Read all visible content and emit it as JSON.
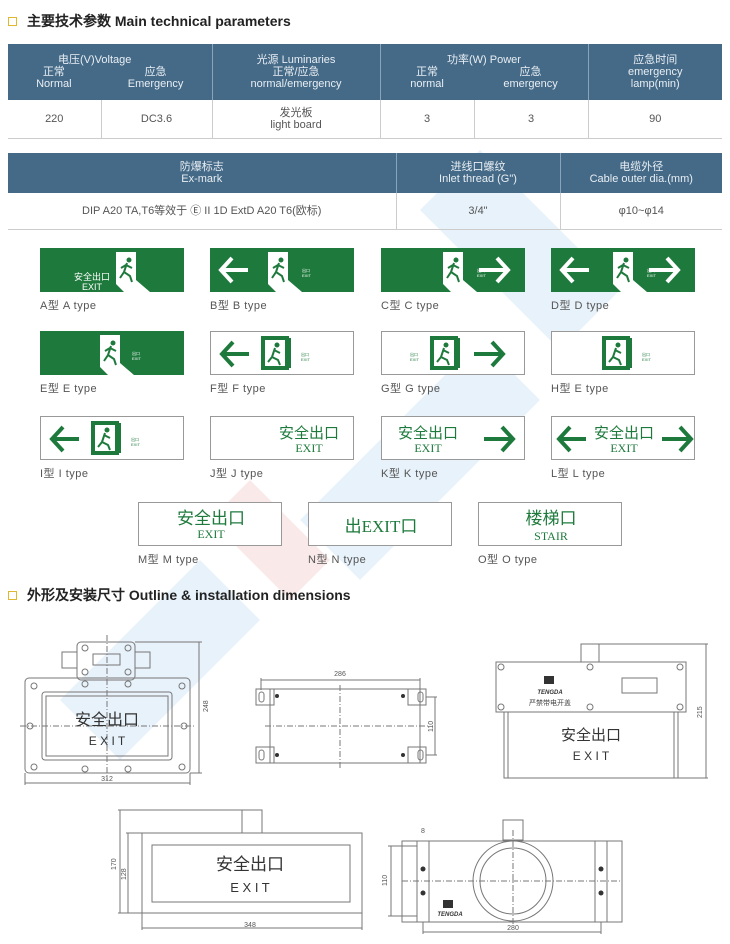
{
  "sections": {
    "params_title": "主要技术参数 Main technical parameters",
    "dims_title": "外形及安装尺寸  Outline & installation dimensions"
  },
  "table1": {
    "voltage": {
      "title": "电压(V)Voltage",
      "normal_cn": "正常",
      "normal_en": "Normal",
      "emergency_cn": "应急",
      "emergency_en": "Emergency"
    },
    "luminaries": {
      "title": "光源 Luminaries",
      "sub_cn": "正常/应急",
      "sub_en": "normal/emergency"
    },
    "power": {
      "title": "功率(W) Power",
      "normal_cn": "正常",
      "normal_en": "normal",
      "emergency_cn": "应急",
      "emergency_en": "emergency"
    },
    "time": {
      "title_cn": "应急时间",
      "title_en1": "emergency",
      "title_en2": "lamp(min)"
    },
    "row": {
      "v_normal": "220",
      "v_emergency": "DC3.6",
      "lum_cn": "发光板",
      "lum_en": "light board",
      "p_normal": "3",
      "p_emergency": "3",
      "time": "90"
    }
  },
  "table2": {
    "exmark": {
      "title_cn": "防爆标志",
      "title_en": "Ex-mark"
    },
    "inlet": {
      "title_cn": "进线口螺纹",
      "title_en": "Inlet thread (G\")"
    },
    "cable": {
      "title_cn": "电缆外径",
      "title_en": "Cable outer dia.(mm)"
    },
    "row": {
      "exmark": "DIP A20 TA,T6等效于 Ⓔ II 1D ExtD A20 T6(欧标)",
      "inlet": "3/4\"",
      "cable": "φ10~φ14"
    }
  },
  "sign_text": {
    "cn": "安全出口",
    "exit": "EXIT",
    "tiny_cn": "出口",
    "exit_mid": "出EXIT口",
    "stair_cn": "楼梯口",
    "stair_en": "STAIR"
  },
  "sign_types": [
    {
      "caption": "A型 A type"
    },
    {
      "caption": "B型 B type"
    },
    {
      "caption": "C型 C type"
    },
    {
      "caption": "D型 D type"
    },
    {
      "caption": "E型 E type"
    },
    {
      "caption": "F型 F type"
    },
    {
      "caption": "G型 G type"
    },
    {
      "caption": "H型 E type"
    },
    {
      "caption": "I型 I type"
    },
    {
      "caption": "J型 J type"
    },
    {
      "caption": "K型 K type"
    },
    {
      "caption": "L型 L type"
    },
    {
      "caption": "M型 M type"
    },
    {
      "caption": "N型 N type"
    },
    {
      "caption": "O型 O type"
    }
  ],
  "drawings": {
    "front": {
      "cn": "安全出口",
      "en": "E X I T",
      "width": "312",
      "height": "248"
    },
    "back": {
      "width": "286",
      "height": "110"
    },
    "side": {
      "cn": "安全出口",
      "en": "E X I T",
      "brand": "TENGDA",
      "warning": "严禁带电开盖",
      "height": "215"
    },
    "bottom": {
      "cn": "安全出口",
      "en": "E X I T",
      "width": "348",
      "height_outer": "170",
      "height_inner": "128"
    },
    "top": {
      "brand": "TENGDA",
      "width": "280",
      "height": "110",
      "slot": "8"
    }
  },
  "colors": {
    "header_bg": "#456a87",
    "sign_green": "#1e7a3c",
    "accent_square": "#e0b830"
  }
}
